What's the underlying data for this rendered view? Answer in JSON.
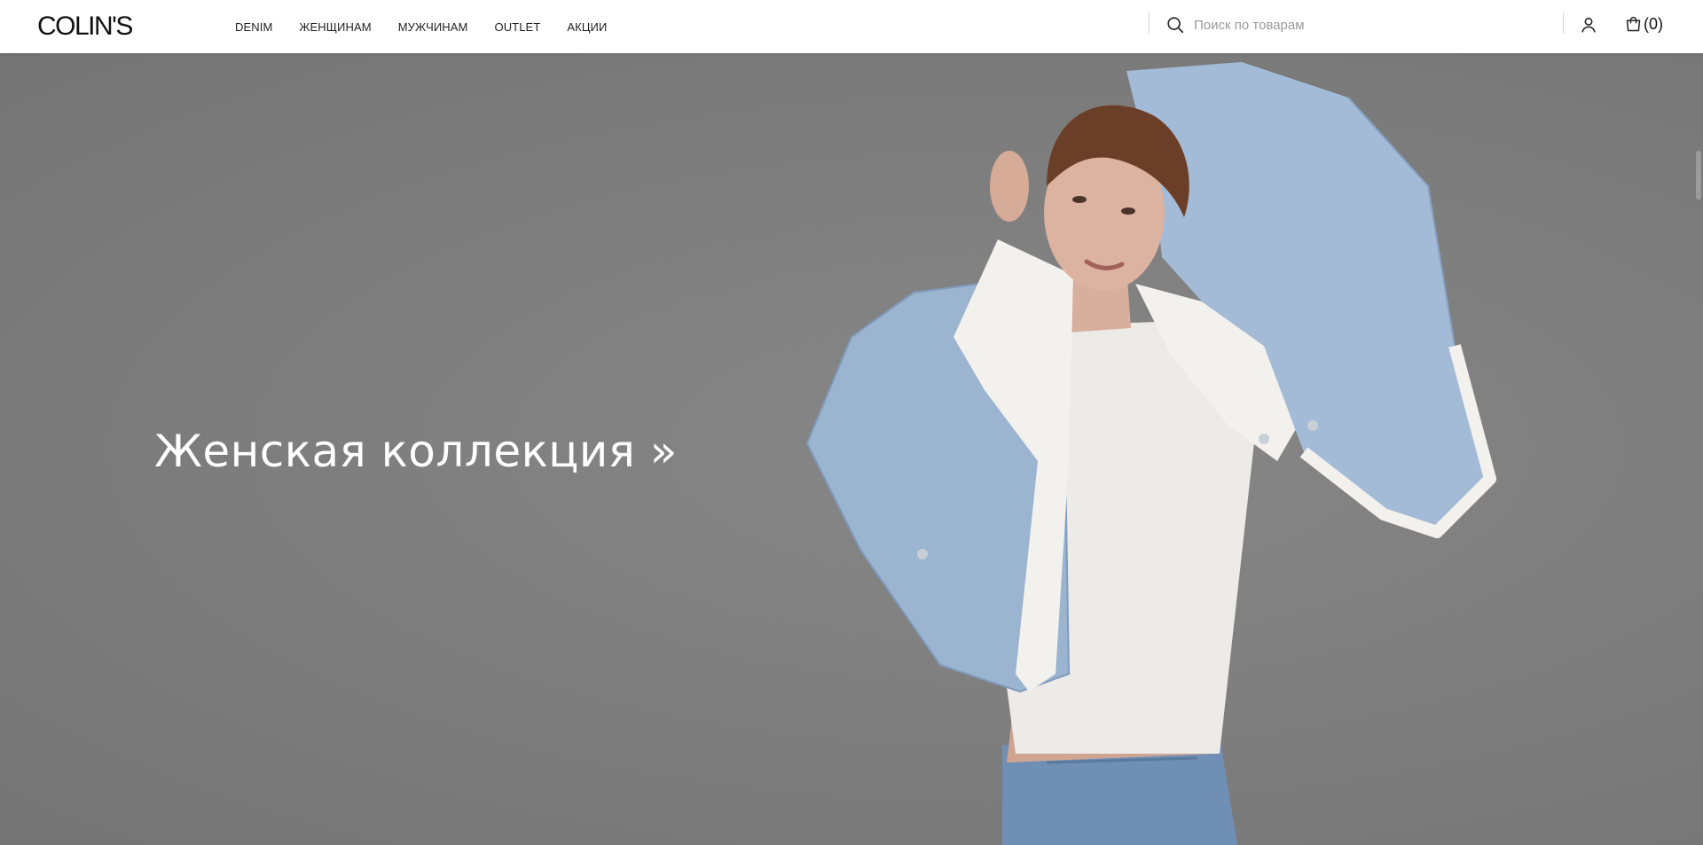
{
  "header": {
    "logo": "COLIN'S",
    "nav": [
      "DENIM",
      "ЖЕНЩИНАМ",
      "МУЖЧИНАМ",
      "OUTLET",
      "АКЦИИ"
    ],
    "search_placeholder": "Поиск по товарам",
    "cart_count": "(0)",
    "icons": [
      "search-icon",
      "user-icon",
      "shopping-bag-icon"
    ]
  },
  "hero": {
    "title": "Женская коллекция »",
    "background_color": "#808080",
    "text_color": "#ffffff"
  }
}
